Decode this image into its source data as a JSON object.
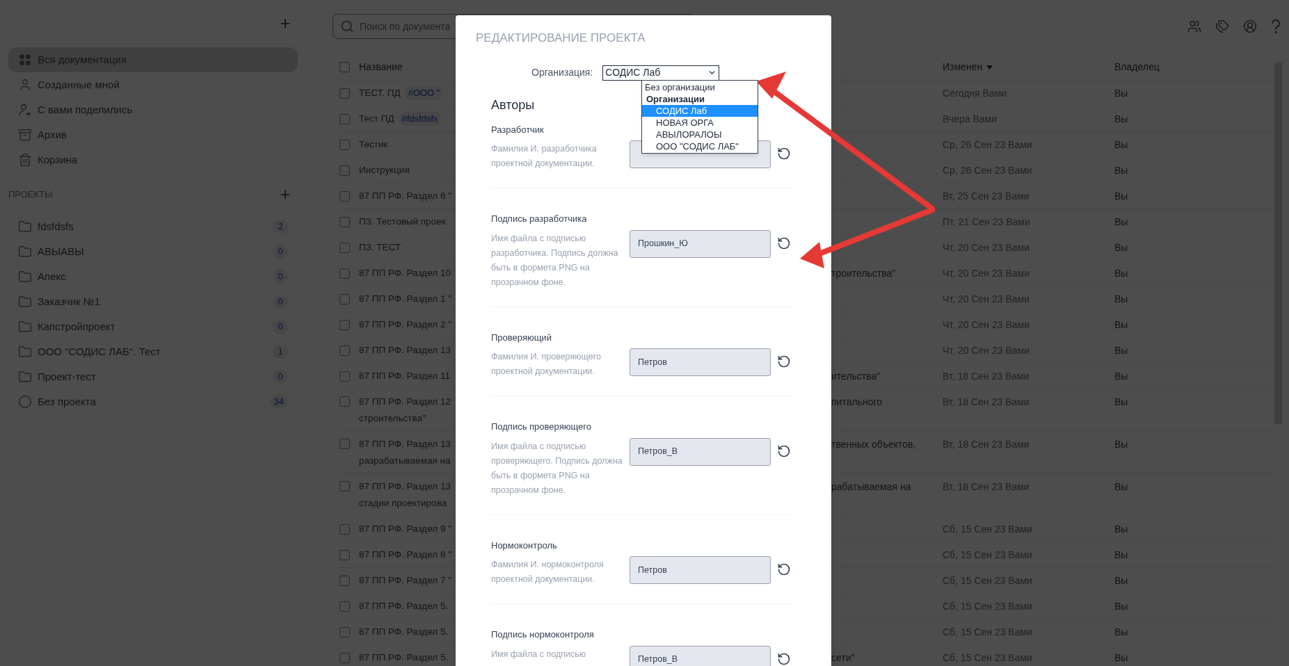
{
  "sidebar": {
    "nav": [
      {
        "label": "Вся документация",
        "kind": "grid",
        "selected": true
      },
      {
        "label": "Созданные мной",
        "kind": "user",
        "selected": false
      },
      {
        "label": "С вами поделились",
        "kind": "shared",
        "selected": false
      },
      {
        "label": "Архив",
        "kind": "archive",
        "selected": false
      },
      {
        "label": "Корзина",
        "kind": "trash",
        "selected": false
      }
    ],
    "projects_title": "ПРОЕКТЫ",
    "projects": [
      {
        "label": "fdsfdsfs",
        "count": "2",
        "kind": "folder"
      },
      {
        "label": "АВЫАВЫ",
        "count": "0",
        "kind": "folder"
      },
      {
        "label": "Апекс",
        "count": "0",
        "kind": "folder"
      },
      {
        "label": "Заказчик №1",
        "count": "0",
        "kind": "folder"
      },
      {
        "label": "Капстройпроект",
        "count": "0",
        "kind": "folder"
      },
      {
        "label": "ООО \"СОДИС ЛАБ\". Тест",
        "count": "1",
        "kind": "folder"
      },
      {
        "label": "Проект-тест",
        "count": "0",
        "kind": "folder"
      },
      {
        "label": "Без проекта",
        "count": "34",
        "kind": "none"
      }
    ]
  },
  "search": {
    "placeholder": "Поиск по документа"
  },
  "table": {
    "select_all": {
      "checked": false
    },
    "columns": {
      "name": "Название",
      "changed": "Изменен",
      "owner": "Владелец"
    },
    "rows": [
      {
        "name": [
          "ТЕСТ. ПД"
        ],
        "tag": "#ООО \"",
        "changed": "Сегодня Вами",
        "owner": "Вы",
        "checked": false
      },
      {
        "name": [
          "Тест ПД"
        ],
        "tag": "#fdsfdsfs",
        "changed": "Вчера Вами",
        "owner": "Вы",
        "checked": false
      },
      {
        "name": [
          "Тестик"
        ],
        "changed": "Ср, 26 Сен 23 Вами",
        "owner": "Вы",
        "checked": false
      },
      {
        "name": [
          "Инструкция"
        ],
        "changed": "Ср, 26 Сен 23 Вами",
        "owner": "Вы",
        "checked": false
      },
      {
        "name": [
          "87 ПП РФ. Раздел 6 \""
        ],
        "changed": "Вт, 25 Сен 23 Вами",
        "owner": "Вы",
        "checked": false
      },
      {
        "name": [
          "ПЗ. Тестовый проек"
        ],
        "changed": "Пт, 21 Сен 23 Вами",
        "owner": "Вы",
        "checked": false
      },
      {
        "name": [
          "ПЗ. ТЕСТ"
        ],
        "changed": "Чт, 20 Сен 23 Вами",
        "owner": "Вы",
        "checked": false
      },
      {
        "name": [
          "87 ПП РФ. Раздел 10"
        ],
        "column_2": "троительства\"",
        "changed": "Чт, 20 Сен 23 Вами",
        "owner": "Вы",
        "checked": false
      },
      {
        "name": [
          "87 ПП РФ. Раздел 1 \""
        ],
        "changed": "Чт, 20 Сен 23 Вами",
        "owner": "Вы",
        "checked": false
      },
      {
        "name": [
          "87 ПП РФ. Раздел 2 \""
        ],
        "changed": "Чт, 20 Сен 23 Вами",
        "owner": "Вы",
        "checked": false
      },
      {
        "name": [
          "87 ПП РФ. Раздел 13"
        ],
        "changed": "Чт, 20 Сен 23 Вами",
        "owner": "Вы",
        "checked": false
      },
      {
        "name": [
          "87 ПП РФ. Раздел 11"
        ],
        "column_2": "ительства\"",
        "changed": "Вт, 18 Сен 23 Вами",
        "owner": "Вы",
        "checked": false
      },
      {
        "name": [
          "87 ПП РФ. Раздел 12",
          "строительства\""
        ],
        "column_2": "питального",
        "changed": "Вт, 18 Сен 23 Вами",
        "owner": "Вы",
        "checked": false
      },
      {
        "name": [
          "87 ПП РФ. Раздел 13",
          "разрабатываемая на"
        ],
        "column_2": "твенных объектов,",
        "changed": "Вт, 18 Сен 23 Вами",
        "owner": "Вы",
        "checked": false
      },
      {
        "name": [
          "87 ПП РФ. Раздел 13",
          "стадии проектирова"
        ],
        "column_2": "рабатываемая на",
        "changed": "Вт, 18 Сен 23 Вами",
        "owner": "Вы",
        "checked": false
      },
      {
        "name": [
          "87 ПП РФ. Раздел 9 \""
        ],
        "changed": "Сб, 15 Сен 23 Вами",
        "owner": "Вы",
        "checked": false
      },
      {
        "name": [
          "87 ПП РФ. Раздел 8 \""
        ],
        "changed": "Сб, 15 Сен 23 Вами",
        "owner": "Вы",
        "checked": false
      },
      {
        "name": [
          "87 ПП РФ. Раздел 7 \""
        ],
        "changed": "Сб, 15 Сен 23 Вами",
        "owner": "Вы",
        "checked": false
      },
      {
        "name": [
          "87 ПП РФ. Раздел 5."
        ],
        "changed": "Сб, 15 Сен 23 Вами",
        "owner": "Вы",
        "checked": false
      },
      {
        "name": [
          "87 ПП РФ. Раздел 5."
        ],
        "changed": "Сб, 15 Сен 23 Вами",
        "owner": "Вы",
        "checked": false
      },
      {
        "name": [
          "87 ПП РФ. Раздел 5."
        ],
        "column_2": "сети\"",
        "changed": "Сб, 15 Сен 23 Вами",
        "owner": "Вы",
        "checked": false
      }
    ]
  },
  "modal": {
    "title": "РЕДАКТИРОВАНИЕ ПРОЕКТА",
    "organization": {
      "label": "Организация:",
      "value": "СОДИС Лаб",
      "expanded": true,
      "options": [
        {
          "label": "Без организации",
          "kind": "option",
          "selected": false
        },
        {
          "label": "Организации",
          "kind": "group",
          "selected": false
        },
        {
          "label": "СОДИС Лаб",
          "kind": "child",
          "selected": true
        },
        {
          "label": "НОВАЯ ОРГА",
          "kind": "child",
          "selected": false
        },
        {
          "label": "АВЫЛОРАЛОЫ",
          "kind": "child",
          "selected": false
        },
        {
          "label": "ООО \"СОДИС ЛАБ\"",
          "kind": "child",
          "selected": false
        }
      ]
    },
    "section_title": "Авторы",
    "fields": [
      {
        "label": "Разработчик",
        "hint": "Фамилия И. разработчика проектной документации."
      },
      {
        "label": "Подпись разработчика",
        "hint": "Имя файла с подписью разработчика. Подпись должна быть в формета PNG на прозрачном фоне.",
        "value": "Прошкин_Ю"
      },
      {
        "label": "Проверяющий",
        "hint": "Фамилия И. проверяющего проектной документации.",
        "value": "Петров"
      },
      {
        "label": "Подпись проверяющего",
        "hint": "Имя файла с подписью проверяющего. Подпись должна быть в формета PNG на прозрачном фоне.",
        "value": "Петров_В"
      },
      {
        "label": "Нормоконтроль",
        "hint": "Фамилия И. нормоконтроля проектной документации.",
        "value": "Петров"
      },
      {
        "label": "Подпись нормоконтроля",
        "hint": "Имя файла с подписью",
        "value": "Петров_В"
      }
    ]
  }
}
